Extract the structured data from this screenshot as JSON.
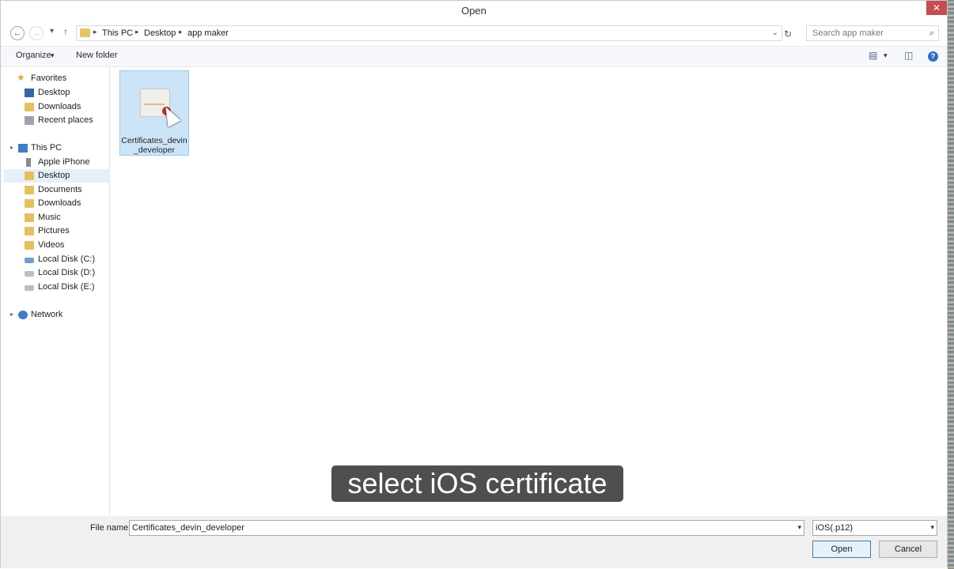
{
  "window": {
    "title": "Open",
    "close_label": "✕"
  },
  "navigation": {
    "back": "←",
    "forward": "→",
    "recent": "▾",
    "up": "↑",
    "breadcrumbs": [
      "This PC",
      "Desktop",
      "app maker"
    ],
    "address_dropdown": "⌄",
    "refresh": "↻",
    "search_placeholder": "Search app maker",
    "search_icon": "⌕"
  },
  "toolbar": {
    "organize": "Organize",
    "organize_arrow": "▾",
    "new_folder": "New folder",
    "view_arrow": "▾",
    "help": "?"
  },
  "sidebar": {
    "favorites": {
      "label": "Favorites",
      "items": [
        "Desktop",
        "Downloads",
        "Recent places"
      ]
    },
    "this_pc": {
      "label": "This PC",
      "items": [
        "Apple iPhone",
        "Desktop",
        "Documents",
        "Downloads",
        "Music",
        "Pictures",
        "Videos",
        "Local Disk (C:)",
        "Local Disk (D:)",
        "Local Disk (E:)"
      ],
      "selected": "Desktop"
    },
    "network": {
      "label": "Network"
    }
  },
  "files": [
    {
      "name": "Certificates_devin_developer",
      "icon": "certificate-icon",
      "selected": true
    }
  ],
  "caption": "select iOS certificate",
  "footer": {
    "file_name_label": "File name:",
    "file_name_value": "Certificates_devin_developer",
    "file_type": "iOS(.p12)",
    "open_label": "Open",
    "cancel_label": "Cancel"
  },
  "colors": {
    "selection": "#cce4f7",
    "close_button": "#c74b50",
    "caption_bg": "#373737"
  }
}
